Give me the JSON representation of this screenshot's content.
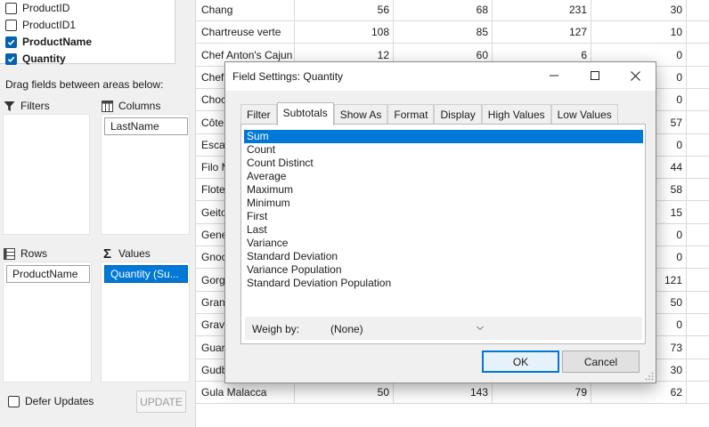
{
  "field_list": [
    {
      "label": "ProductID",
      "checked": false
    },
    {
      "label": "ProductID1",
      "checked": false
    },
    {
      "label": "ProductName",
      "checked": true
    },
    {
      "label": "Quantity",
      "checked": true
    }
  ],
  "areas": {
    "hint": "Drag fields between areas below:",
    "filters_label": "Filters",
    "columns_label": "Columns",
    "columns_field": "LastName",
    "rows_label": "Rows",
    "rows_field": "ProductName",
    "values_label": "Values",
    "values_field": "Quantity (Su..."
  },
  "defer": {
    "label": "Defer Updates",
    "checked": false
  },
  "update_label": "UPDATE",
  "grid": {
    "rows": [
      [
        "Chang",
        "56",
        "68",
        "231",
        "30"
      ],
      [
        "Chartreuse verte",
        "108",
        "85",
        "127",
        "10"
      ],
      [
        "Chef Anton's Cajun",
        "12",
        "60",
        "6",
        "0"
      ],
      [
        "Chef",
        "",
        "",
        "",
        "0"
      ],
      [
        "Choc",
        "",
        "",
        "",
        "0"
      ],
      [
        "Côte",
        "",
        "",
        "",
        "57"
      ],
      [
        "Escar",
        "",
        "",
        "",
        "0"
      ],
      [
        "Filo M",
        "",
        "",
        "",
        "44"
      ],
      [
        "Flote",
        "",
        "",
        "",
        "58"
      ],
      [
        "Geito",
        "",
        "",
        "",
        "15"
      ],
      [
        "Gene",
        "",
        "",
        "",
        "0"
      ],
      [
        "Gnoc",
        "",
        "",
        "",
        "0"
      ],
      [
        "Gorg",
        "",
        "",
        "",
        "121"
      ],
      [
        "Gran",
        "",
        "",
        "",
        "50"
      ],
      [
        "Grava",
        "",
        "",
        "",
        "0"
      ],
      [
        "Guar",
        "",
        "",
        "",
        "73"
      ],
      [
        "Gudb",
        "",
        "",
        "",
        "30"
      ],
      [
        "Gula Malacca",
        "50",
        "143",
        "79",
        "62"
      ]
    ]
  },
  "dialog": {
    "title": "Field Settings: Quantity",
    "tabs": [
      "Filter",
      "Subtotals",
      "Show As",
      "Format",
      "Display",
      "High Values",
      "Low Values"
    ],
    "active_tab": "Subtotals",
    "functions": [
      "Sum",
      "Count",
      "Count Distinct",
      "Average",
      "Maximum",
      "Minimum",
      "First",
      "Last",
      "Variance",
      "Standard Deviation",
      "Variance Population",
      "Standard Deviation Population"
    ],
    "selected_function": "Sum",
    "weigh_by_label": "Weigh by:",
    "weigh_by_value": "(None)",
    "ok_label": "OK",
    "cancel_label": "Cancel"
  },
  "colors": {
    "accent": "#0078d7",
    "selection": "#0078d7",
    "panel_bg": "#f0f0f0"
  }
}
